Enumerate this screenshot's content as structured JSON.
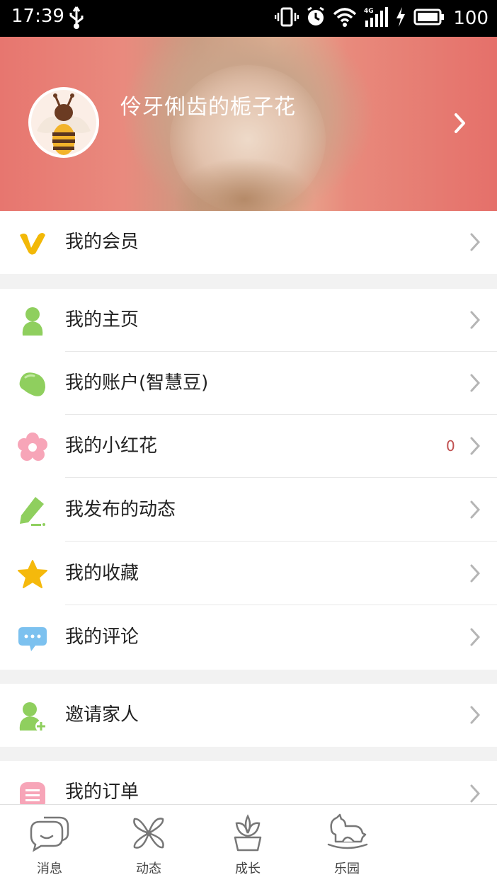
{
  "status_bar": {
    "time": "17:39",
    "network": "4G",
    "battery": "100"
  },
  "profile": {
    "username": "伶牙俐齿的栀子花",
    "avatar": "bee-avatar",
    "background_color": "#e7766f"
  },
  "menu": {
    "membership": {
      "label": "我的会员",
      "icon": "vip-v-icon",
      "color": "#f2b807"
    },
    "homepage": {
      "label": "我的主页",
      "icon": "person-icon",
      "color": "#8fcf5e"
    },
    "account": {
      "label": "我的账户(智慧豆)",
      "icon": "bean-icon",
      "color": "#8fcf5e"
    },
    "red_flower": {
      "label": "我的小红花",
      "icon": "flower-icon",
      "color": "#f7a5b8",
      "count": "0"
    },
    "posts": {
      "label": "我发布的动态",
      "icon": "pencil-icon",
      "color": "#8fcf5e"
    },
    "favorites": {
      "label": "我的收藏",
      "icon": "star-icon",
      "color": "#f5b90c"
    },
    "comments": {
      "label": "我的评论",
      "icon": "chat-bubble-icon",
      "color": "#7cc1ef"
    },
    "invite": {
      "label": "邀请家人",
      "icon": "add-person-icon",
      "color": "#8fcf5e"
    },
    "orders": {
      "label": "我的订单",
      "icon": "list-icon",
      "color": "#f7a5b8"
    }
  },
  "bottom_nav": {
    "tabs": [
      {
        "label": "消息",
        "icon": "message-icon"
      },
      {
        "label": "动态",
        "icon": "pinwheel-icon"
      },
      {
        "label": "成长",
        "icon": "plant-pot-icon"
      },
      {
        "label": "乐园",
        "icon": "rocking-horse-icon"
      }
    ]
  }
}
